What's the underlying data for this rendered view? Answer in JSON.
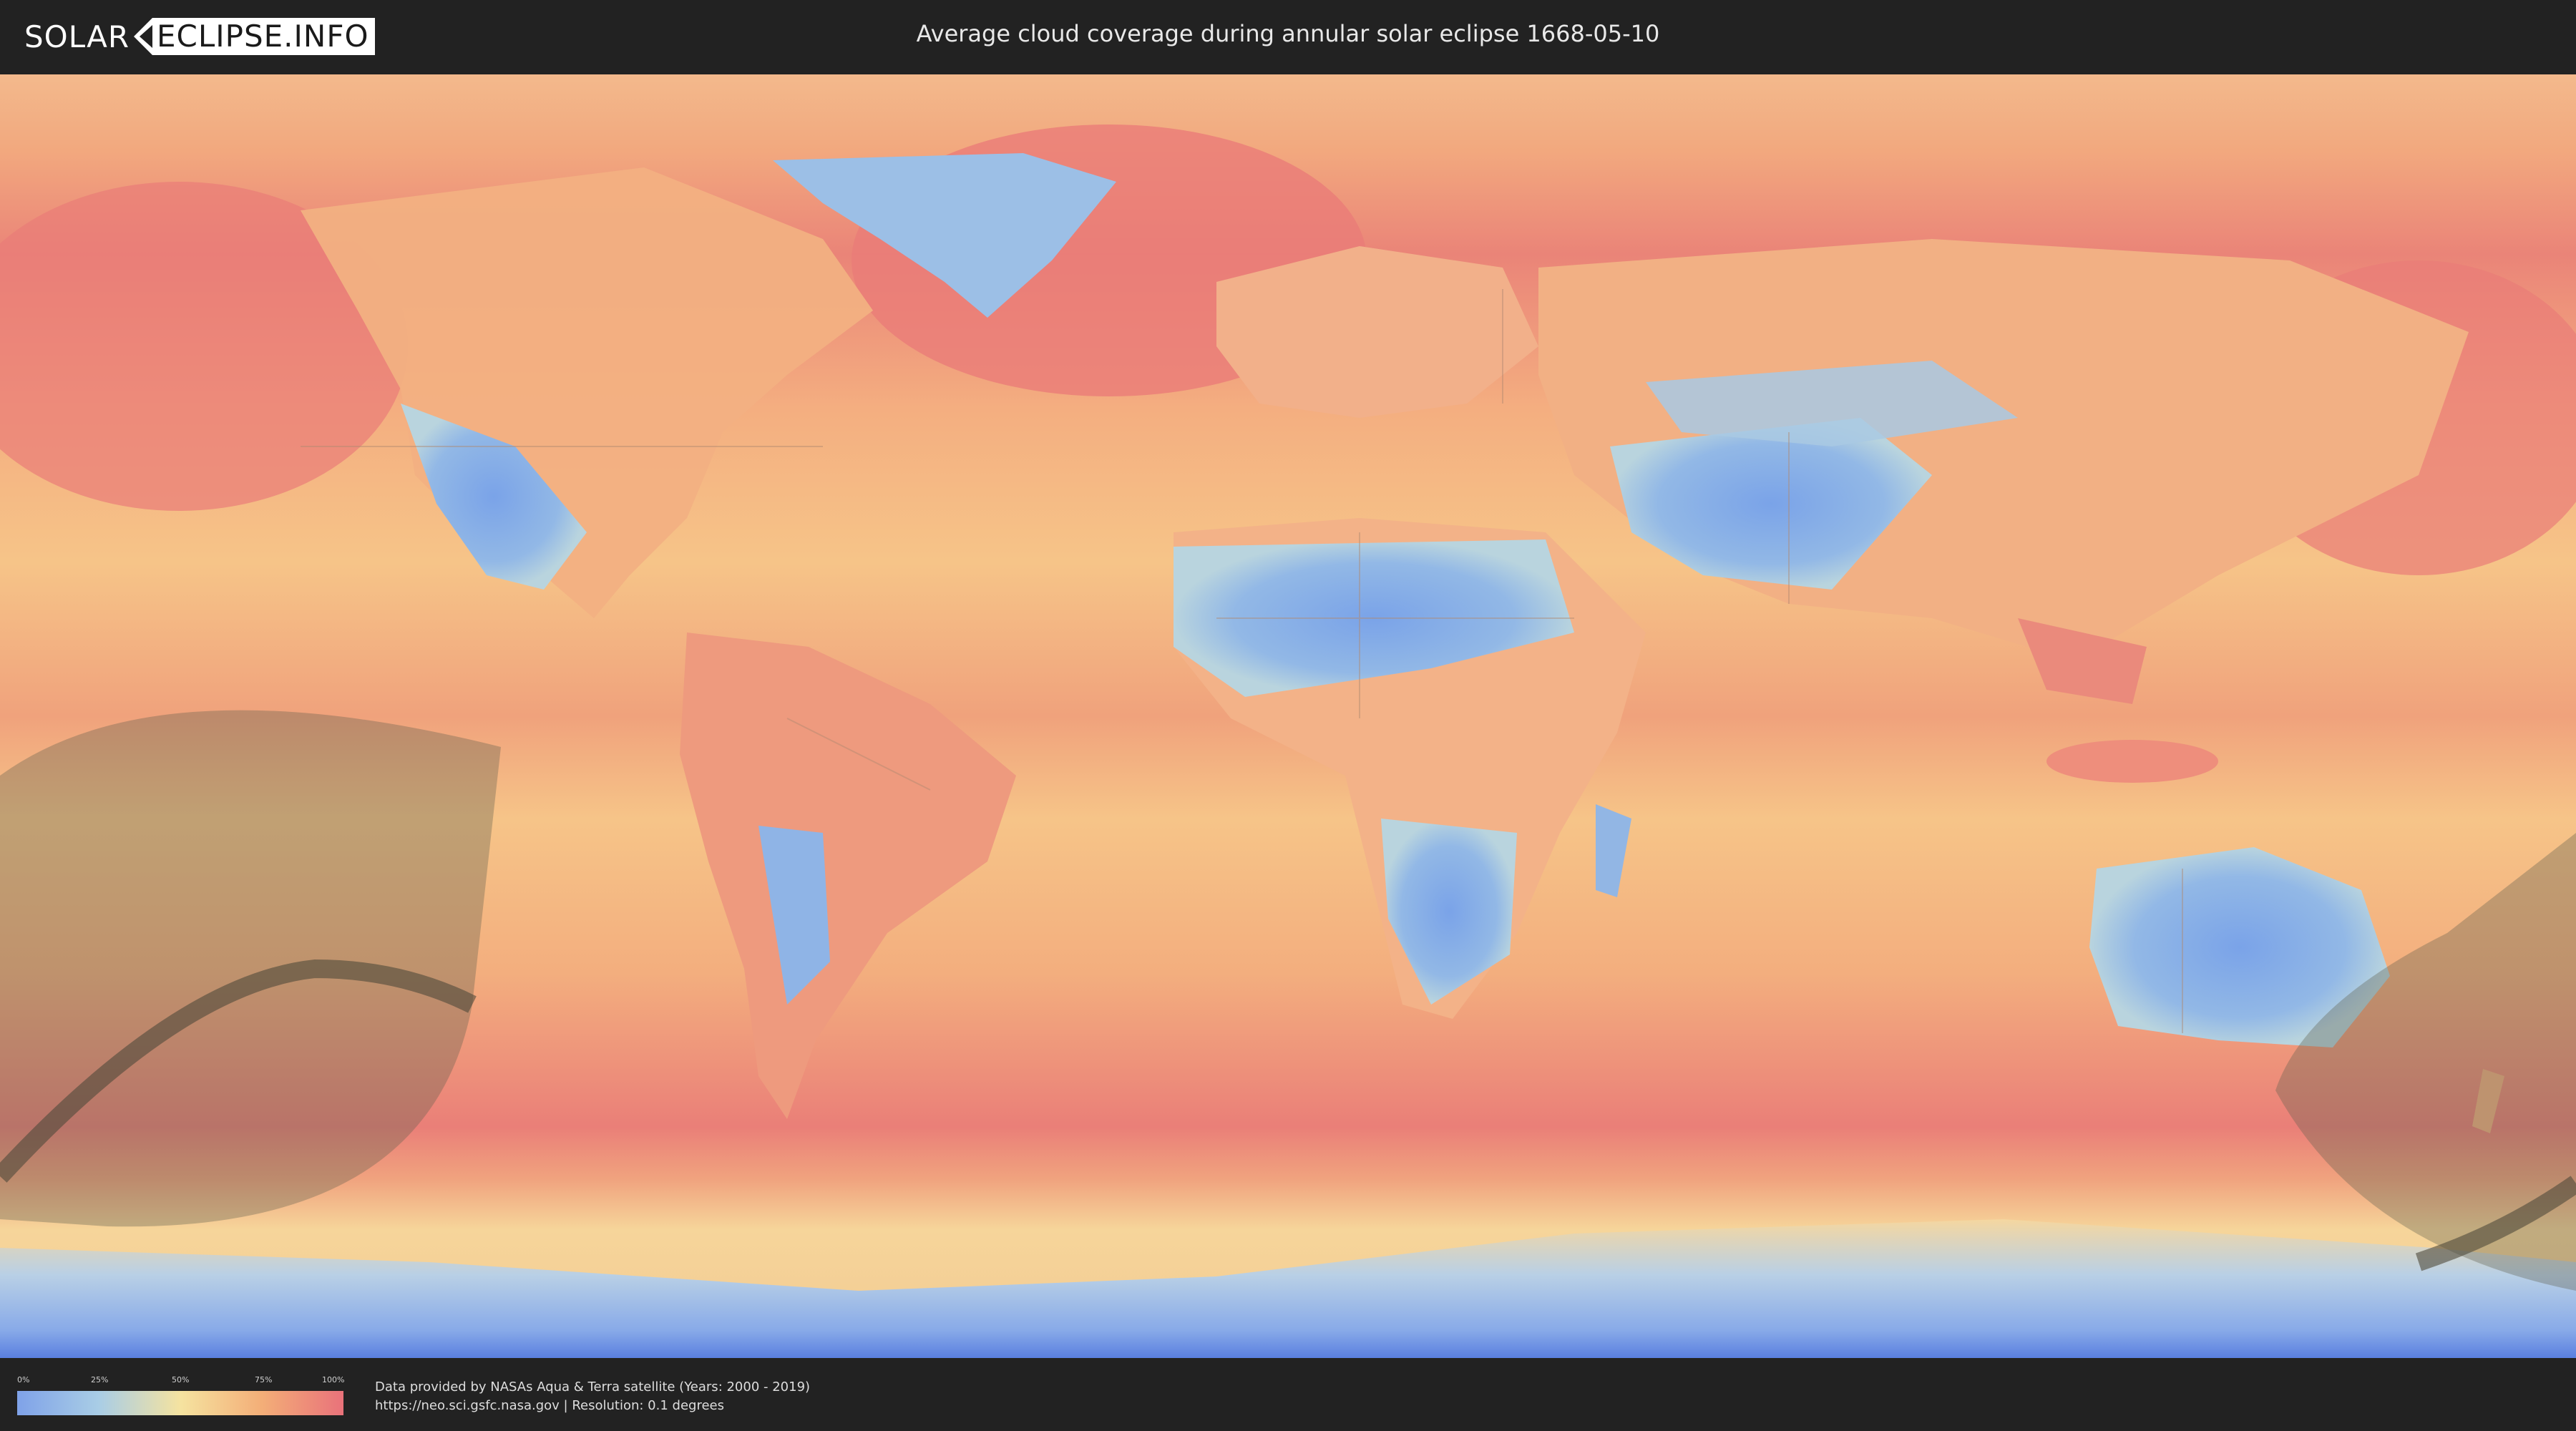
{
  "header": {
    "logo_left": "SOLAR",
    "logo_right": "ECLIPSE.INFO",
    "title": "Average cloud coverage during annular solar eclipse 1668-05-10"
  },
  "legend": {
    "ticks": [
      "0%",
      "25%",
      "50%",
      "75%",
      "100%"
    ],
    "gradient_colors": [
      "#7fa2e8",
      "#a9cde6",
      "#f5e3a0",
      "#f3ae78",
      "#e9727a"
    ]
  },
  "footer": {
    "source_line1": "Data provided by NASAs Aqua & Terra satellite (Years: 2000 - 2019)",
    "source_line2": "https://neo.sci.gsfc.nasa.gov | Resolution: 0.1 degrees"
  },
  "colors": {
    "ocean_cloudy": "#ed8c7c",
    "ocean_mid": "#f6b985",
    "clear_land": "#7ea6e6",
    "eclipse_shade": "#6e6e5a",
    "eclipse_path": "#4e4a3a"
  }
}
